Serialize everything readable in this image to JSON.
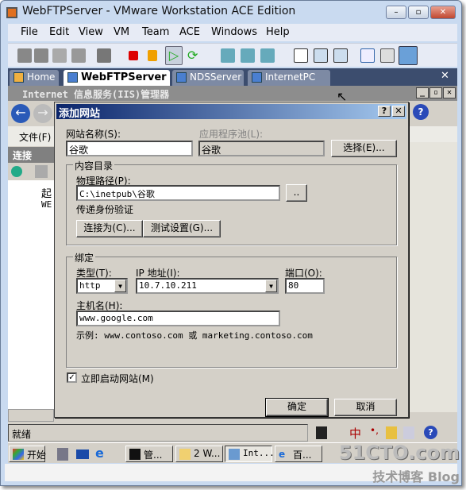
{
  "window": {
    "title": "WebFTPServer - VMware Workstation ACE Edition",
    "min": "–",
    "max": "▫",
    "close": "✕"
  },
  "menu": [
    "File",
    "Edit",
    "View",
    "VM",
    "Team",
    "ACE",
    "Windows",
    "Help"
  ],
  "tabs": [
    {
      "label": "Home"
    },
    {
      "label": "WebFTPServer"
    },
    {
      "label": "NDSServer"
    },
    {
      "label": "InternetPC"
    }
  ],
  "tabs_close": "✕",
  "iis": {
    "title": "Internet 信息服务(IIS)管理器",
    "menu_file": "文件(F)",
    "connections": "连接",
    "tree": [
      "起",
      "WE"
    ],
    "status": "就绪"
  },
  "dialog": {
    "title": "添加网站",
    "help": "?",
    "close": "✕",
    "site_name_label": "网站名称(S):",
    "site_name": "谷歌",
    "app_pool_label": "应用程序池(L):",
    "app_pool": "谷歌",
    "select_button": "选择(E)...",
    "content_group": "内容目录",
    "physical_path_label": "物理路径(P):",
    "physical_path": "C:\\inetpub\\谷歌",
    "browse_button": "..",
    "pass_auth": "传递身份验证",
    "connect_as_button": "连接为(C)...",
    "test_settings_button": "测试设置(G)...",
    "binding_group": "绑定",
    "type_label": "类型(T):",
    "type": "http",
    "ip_label": "IP 地址(I):",
    "ip": "10.7.10.211",
    "port_label": "端口(O):",
    "port": "80",
    "host_label": "主机名(H):",
    "host": "www.google.com",
    "example": "示例: www.contoso.com 或 marketing.contoso.com",
    "start_checkbox": "立即启动网站(M)",
    "start_checked": true,
    "ok": "确定",
    "cancel": "取消"
  },
  "ime": {
    "mode": "中",
    "punct": "•,"
  },
  "taskbar": {
    "start": "开始",
    "items": [
      "管...",
      "2 W...",
      "Int...",
      "百..."
    ]
  },
  "watermark": {
    "site": "51CTO.com",
    "blog": "技术博客 Blog"
  }
}
